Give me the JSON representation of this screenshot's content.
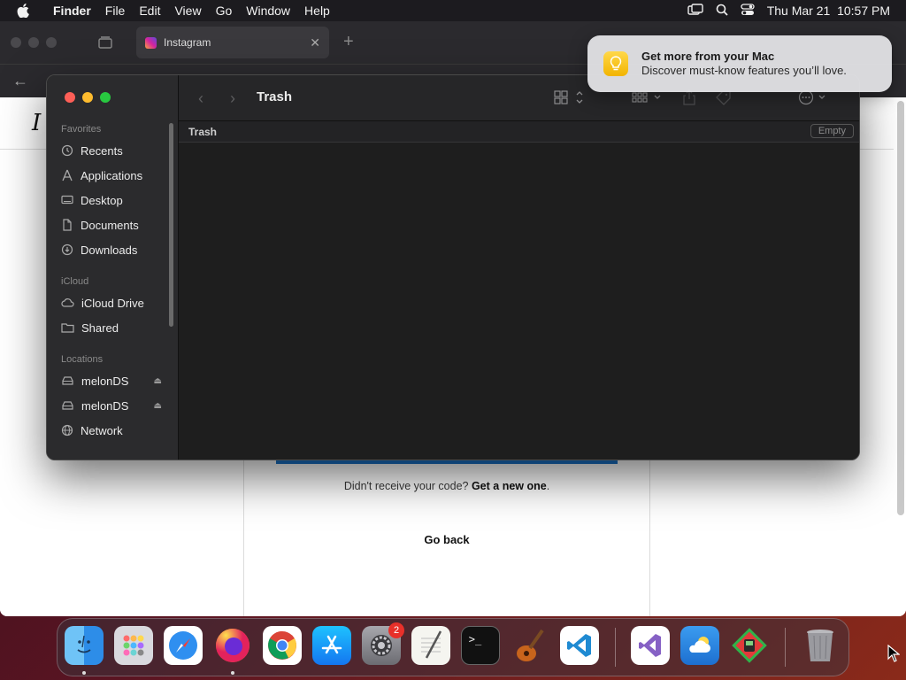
{
  "menubar": {
    "app_name": "Finder",
    "items": [
      "File",
      "Edit",
      "View",
      "Go",
      "Window",
      "Help"
    ],
    "clock": "Thu Mar 21  10:57 PM"
  },
  "browser": {
    "tab_title": "Instagram",
    "page": {
      "resend_prefix": "Didn't receive your code?",
      "resend_link": "Get a new one",
      "resend_suffix": ".",
      "go_back": "Go back"
    }
  },
  "finder": {
    "title": "Trash",
    "path_label": "Trash",
    "empty_button": "Empty",
    "sections": {
      "favorites": "Favorites",
      "icloud": "iCloud",
      "locations": "Locations"
    },
    "favorites": [
      "Recents",
      "Applications",
      "Desktop",
      "Documents",
      "Downloads"
    ],
    "icloud": [
      "iCloud Drive",
      "Shared"
    ],
    "locations": [
      "melonDS",
      "melonDS",
      "Network"
    ]
  },
  "notification": {
    "title": "Get more from your Mac",
    "body": "Discover must-know features you’ll love."
  },
  "dock": {
    "settings_badge": "2",
    "apps": [
      "finder-icon",
      "launchpad-icon",
      "safari-icon",
      "firefox-icon",
      "chrome-icon",
      "app-store-icon",
      "system-settings-icon",
      "textedit-icon",
      "terminal-icon",
      "garageband-icon",
      "vscode-icon",
      "visual-studio-icon",
      "weather-icon",
      "melonds-icon",
      "trash-icon"
    ]
  },
  "colors": {
    "close": "#fe5f57",
    "minimize": "#febc2e",
    "zoom": "#28c840",
    "accent_blue": "#1a73c9"
  }
}
